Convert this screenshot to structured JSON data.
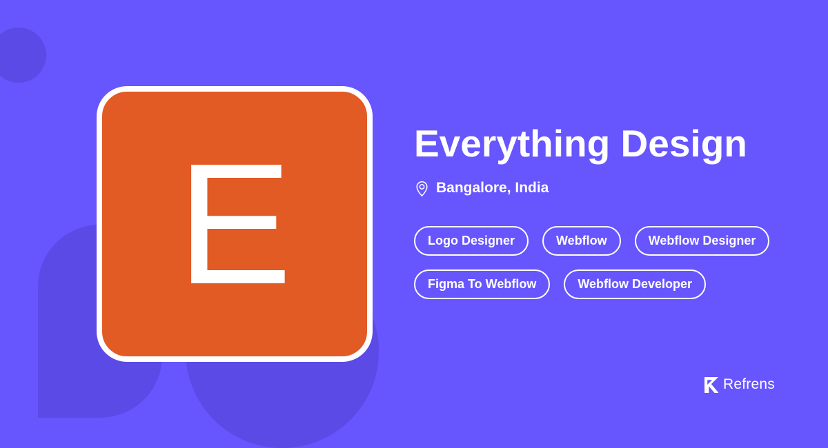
{
  "profile": {
    "initial": "E",
    "name": "Everything Design",
    "location": "Bangalore, India",
    "avatar_color": "#e25a24",
    "tags": [
      "Logo Designer",
      "Webflow",
      "Webflow Designer",
      "Figma To Webflow",
      "Webflow Developer"
    ]
  },
  "brand": {
    "name": "Refrens",
    "icon": "refrens-logo-icon"
  },
  "theme": {
    "background": "#6755fd",
    "decor": "#5b4ae6",
    "text": "#ffffff"
  },
  "icons": {
    "location": "location-pin-icon"
  }
}
